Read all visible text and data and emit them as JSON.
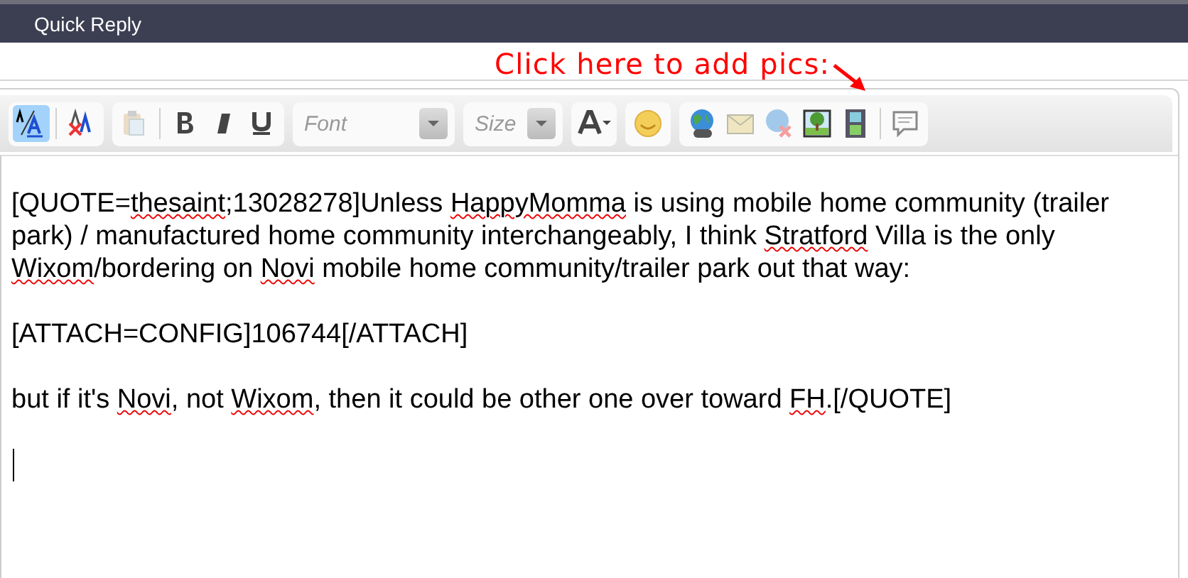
{
  "header": {
    "title": "Quick Reply"
  },
  "annotation": {
    "text": "Click here to add pics:"
  },
  "toolbar": {
    "groups": [
      {
        "buttons": [
          {
            "kind": "source",
            "selected": true,
            "disabled": false
          },
          {
            "kind": "removeformat",
            "selected": false,
            "disabled": false
          }
        ]
      },
      {
        "buttons": [
          {
            "kind": "paste",
            "selected": false,
            "disabled": true
          },
          {
            "kind": "bold",
            "selected": false,
            "disabled": false
          },
          {
            "kind": "italic",
            "selected": false,
            "disabled": false
          },
          {
            "kind": "underline",
            "selected": false,
            "disabled": false
          }
        ]
      },
      {
        "dropdown": {
          "placeholder": "Font"
        }
      },
      {
        "dropdown": {
          "placeholder": "Size"
        }
      },
      {
        "buttons": [
          {
            "kind": "textcolor",
            "selected": false,
            "disabled": false
          }
        ]
      },
      {
        "buttons": [
          {
            "kind": "smiley",
            "selected": false,
            "disabled": false
          }
        ]
      },
      {
        "buttons": [
          {
            "kind": "link",
            "selected": false,
            "disabled": false
          },
          {
            "kind": "email",
            "selected": false,
            "disabled": false
          },
          {
            "kind": "unlink",
            "selected": false,
            "disabled": true
          },
          {
            "kind": "image",
            "selected": false,
            "disabled": false
          },
          {
            "kind": "video",
            "selected": false,
            "disabled": false
          },
          {
            "kind": "quote",
            "selected": false,
            "disabled": false
          }
        ]
      }
    ]
  },
  "editor": {
    "paragraphs": [
      [
        {
          "text": "[QUOTE="
        },
        {
          "text": "thesaint",
          "misspelled": true
        },
        {
          "text": ";13028278]Unless "
        },
        {
          "text": "HappyMomma",
          "misspelled": true
        },
        {
          "text": " is using mobile home community (trailer park) / manufactured home community interchangeably, I think "
        },
        {
          "text": "Stratford",
          "misspelled": true
        },
        {
          "text": " Villa is the only "
        },
        {
          "text": "Wixom",
          "misspelled": true
        },
        {
          "text": "/bordering on "
        },
        {
          "text": "Novi",
          "misspelled": true
        },
        {
          "text": " mobile home community/trailer park out that way:"
        }
      ],
      [
        {
          "text": "[ATTACH=CONFIG]106744[/ATTACH]"
        }
      ],
      [
        {
          "text": "but if it's "
        },
        {
          "text": "Novi",
          "misspelled": true
        },
        {
          "text": ", not "
        },
        {
          "text": "Wixom",
          "misspelled": true
        },
        {
          "text": ", then it could be other one over toward "
        },
        {
          "text": "FH",
          "misspelled": true
        },
        {
          "text": ".[/QUOTE]"
        }
      ]
    ],
    "caret": true
  }
}
